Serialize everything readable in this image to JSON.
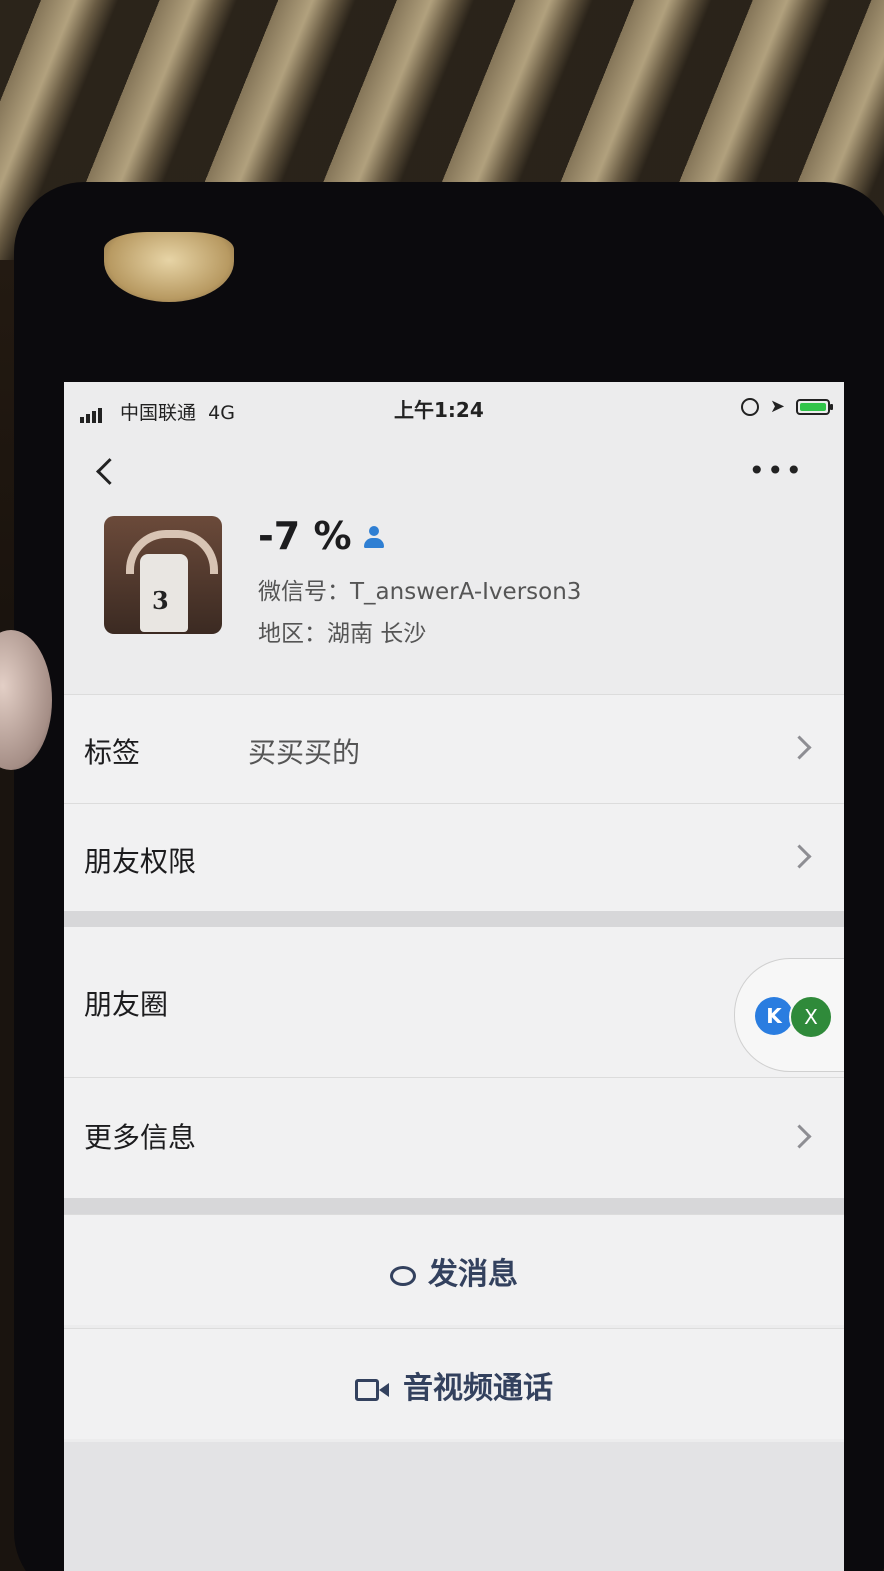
{
  "status_bar": {
    "carrier": "中国联通",
    "network": "4G",
    "time": "上午1:24"
  },
  "nav": {
    "back_icon": "chevron-left-icon",
    "more_icon": "ellipsis-icon"
  },
  "profile": {
    "name": "-7 %",
    "wechat_id": "微信号：T_answerA-Iverson3",
    "region": "地区：湖南 长沙",
    "avatar_number": "3"
  },
  "rows": {
    "tags": {
      "label": "标签",
      "value": "买买买的"
    },
    "permissions": {
      "label": "朋友权限"
    },
    "moments": {
      "label": "朋友圈"
    },
    "more_info": {
      "label": "更多信息"
    }
  },
  "actions": {
    "send_message": "发消息",
    "video_call": "音视频通话"
  },
  "floating": {
    "badge_a": "K",
    "badge_b": "X"
  },
  "colors": {
    "accent_blue": "#2f7fd3",
    "action_text": "#33415e",
    "battery_green": "#31c44a"
  }
}
